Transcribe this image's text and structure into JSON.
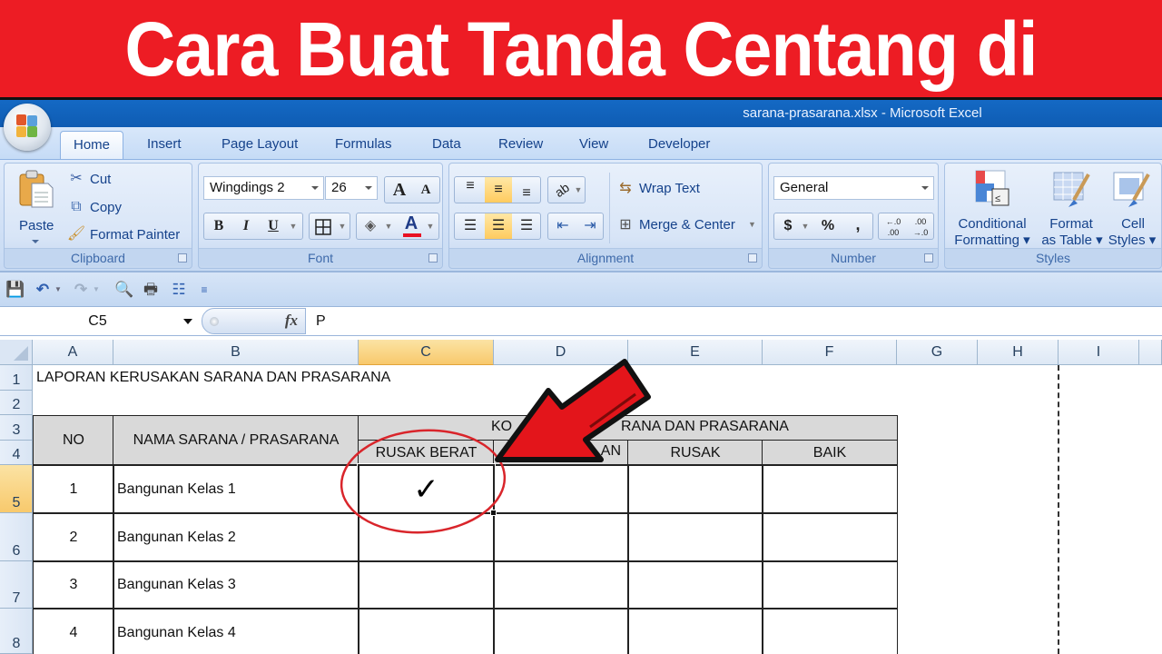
{
  "banner": {
    "title": "Cara Buat Tanda Centang di Excel"
  },
  "window": {
    "title": "sarana-prasarana.xlsx  -  Microsoft Excel"
  },
  "ribbon_tabs": [
    {
      "label": "Home",
      "active": true
    },
    {
      "label": "Insert"
    },
    {
      "label": "Page Layout"
    },
    {
      "label": "Formulas"
    },
    {
      "label": "Data"
    },
    {
      "label": "Review"
    },
    {
      "label": "View"
    },
    {
      "label": "Developer"
    }
  ],
  "clipboard": {
    "label": "Clipboard",
    "paste": "Paste",
    "cut": "Cut",
    "copy": "Copy",
    "format_painter": "Format Painter"
  },
  "font": {
    "label": "Font",
    "font_name": "Wingdings 2",
    "font_size": "26",
    "grow": "A",
    "shrink": "A",
    "bold": "B",
    "italic": "I",
    "underline": "U",
    "font_color": "A",
    "font_color_hex": "#e81123"
  },
  "alignment": {
    "label": "Alignment",
    "wrap_text": "Wrap Text",
    "merge_center": "Merge & Center",
    "active_vertical": "middle",
    "active_horizontal": "center"
  },
  "number": {
    "label": "Number",
    "format": "General",
    "currency": "$",
    "percent": "%",
    "comma": ",",
    "inc_decimal": "←.0 .00",
    "dec_decimal": ".00 →.0"
  },
  "styles": {
    "label": "Styles",
    "conditional_formatting": [
      "Conditional",
      "Formatting ▾"
    ],
    "format_as_table": [
      "Format",
      "as Table ▾"
    ],
    "cell_styles": [
      "Cell",
      "Styles ▾"
    ]
  },
  "formula_bar": {
    "name_box": "C5",
    "fx": "fx",
    "value": "P"
  },
  "columns": [
    "A",
    "B",
    "C",
    "D",
    "E",
    "F",
    "G",
    "H",
    "I"
  ],
  "selected_column": "C",
  "rows": [
    "1",
    "2",
    "3",
    "4",
    "5",
    "6",
    "7",
    "8"
  ],
  "selected_row": "5",
  "sheet": {
    "title": "LAPORAN KERUSAKAN SARANA DAN PRASARANA",
    "header_no": "NO",
    "header_nama": "NAMA SARANA / PRASARANA",
    "header_kondisi_visible_left": "KO",
    "header_kondisi_visible_right": "RANA DAN PRASARANA",
    "sub_headers": [
      "RUSAK BERAT",
      "AN",
      "RUSAK",
      "BAIK"
    ],
    "data_rows": [
      {
        "no": "1",
        "nama": "Bangunan Kelas 1",
        "rusak_berat": "✓",
        "d": "",
        "rusak": "",
        "baik": ""
      },
      {
        "no": "2",
        "nama": "Bangunan Kelas 2",
        "rusak_berat": "",
        "d": "",
        "rusak": "",
        "baik": ""
      },
      {
        "no": "3",
        "nama": "Bangunan Kelas 3",
        "rusak_berat": "",
        "d": "",
        "rusak": "",
        "baik": ""
      },
      {
        "no": "4",
        "nama": "Bangunan Kelas 4",
        "rusak_berat": "",
        "d": "",
        "rusak": "",
        "baik": ""
      }
    ]
  },
  "colors": {
    "banner_red": "#ed1c24",
    "titlebar_blue": "#1469c4",
    "annotation_red": "#e3151b",
    "header_gray": "#d9d9d9",
    "selection_orange": "#f8c96c"
  }
}
